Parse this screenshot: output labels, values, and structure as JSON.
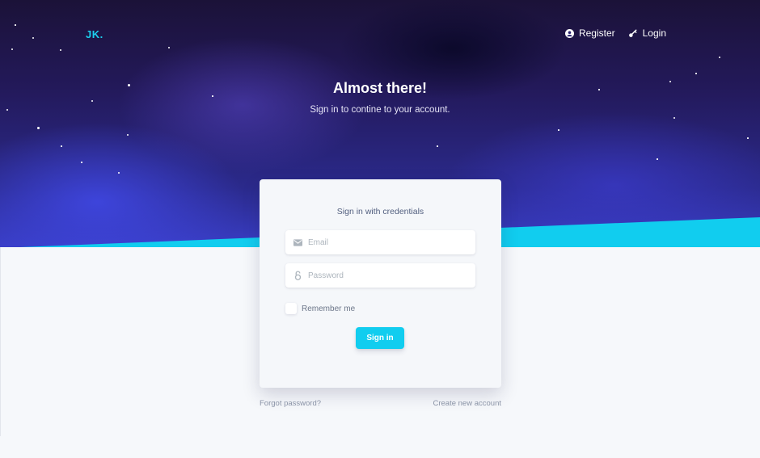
{
  "brand": {
    "logo": "JK."
  },
  "nav": {
    "register_label": "Register",
    "login_label": "Login"
  },
  "hero": {
    "title": "Almost there!",
    "subtitle": "Sign in to contine to your account."
  },
  "login_card": {
    "title": "Sign in with credentials",
    "email_placeholder": "Email",
    "email_value": "",
    "password_placeholder": "Password",
    "password_value": "",
    "remember_label": "Remember me",
    "remember_checked": false,
    "submit_label": "Sign in"
  },
  "footer": {
    "forgot_label": "Forgot password?",
    "create_label": "Create new account"
  },
  "colors": {
    "accent": "#11cdef",
    "hero_dark": "#1b1238",
    "hero_blue": "#3a3fc9",
    "page_bg": "#f6f8fb"
  },
  "icons": {
    "register": "user-circle-icon",
    "login": "key-icon",
    "email": "envelope-icon",
    "password": "lock-icon"
  }
}
